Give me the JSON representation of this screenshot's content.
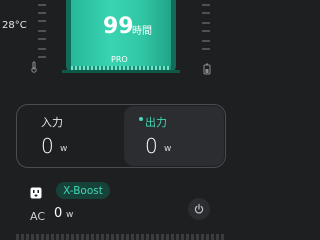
{
  "status": {
    "temperature": "28°C"
  },
  "battery": {
    "remaining_time_value": "99",
    "remaining_time_unit": "時間",
    "model_label": "PRO"
  },
  "power": {
    "input_label": "入力",
    "input_value": "0",
    "input_unit": "w",
    "output_label": "出力",
    "output_value": "0",
    "output_unit": "w",
    "output_active": true
  },
  "controls": {
    "xboost_label": "X-Boost",
    "ac_label": "AC",
    "ac_value": "0",
    "ac_unit": "w"
  },
  "colors": {
    "accent": "#43d7b6",
    "background": "#1d1f21",
    "card": "#2b2d30"
  }
}
